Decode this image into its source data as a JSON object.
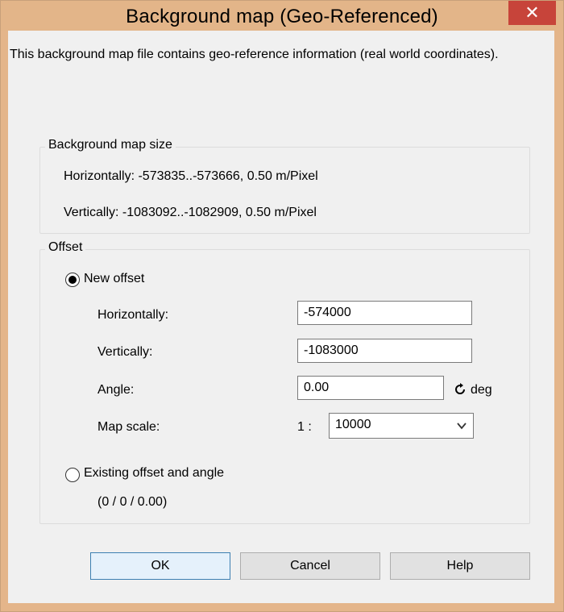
{
  "window": {
    "title": "Background map (Geo-Referenced)",
    "close_glyph": "✕"
  },
  "intro_text": "This background map file contains geo-reference information (real world coordinates).",
  "size_group": {
    "label": "Background map size",
    "horizontal": "Horizontally: -573835..-573666,  0.50 m/Pixel",
    "vertical": "Vertically: -1083092..-1082909,  0.50 m/Pixel"
  },
  "offset_group": {
    "label": "Offset",
    "new_offset": {
      "label": "New offset",
      "selected": true,
      "horizontal_label": "Horizontally:",
      "horizontal_value": "-574000",
      "vertical_label": "Vertically:",
      "vertical_value": "-1083000",
      "angle_label": "Angle:",
      "angle_value": "0.00",
      "angle_unit": "deg",
      "scale_label": "Map scale:",
      "scale_prefix": "1 :",
      "scale_value": "10000"
    },
    "existing_offset": {
      "label": "Existing offset and angle",
      "selected": false,
      "values": "(0 / 0 / 0.00)"
    }
  },
  "buttons": {
    "ok": "OK",
    "cancel": "Cancel",
    "help": "Help"
  },
  "icons": {
    "close": "close-icon",
    "rotate": "rotate-clockwise-icon",
    "dropdown": "chevron-down-icon"
  }
}
